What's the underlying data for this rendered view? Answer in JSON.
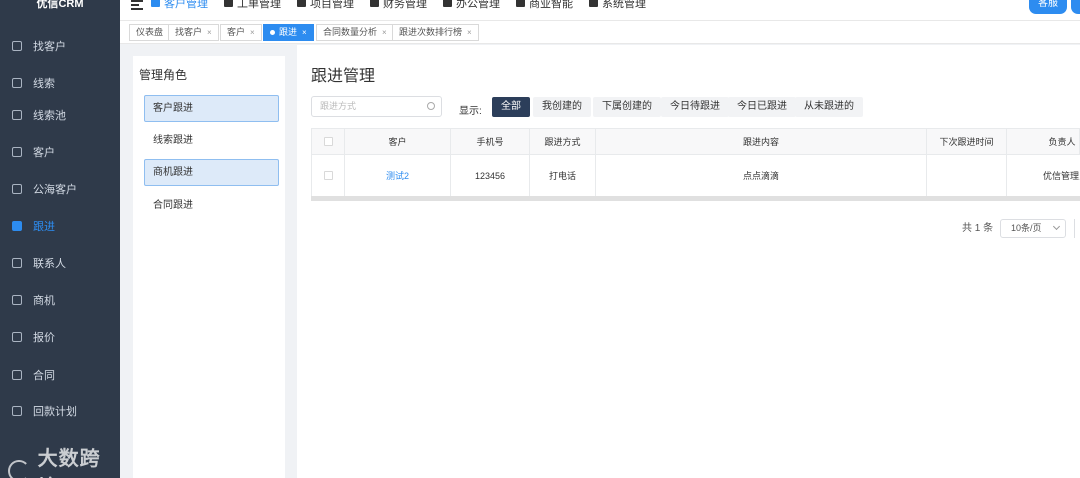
{
  "app": {
    "logo_text": "优信CRM"
  },
  "sidebar": {
    "items": [
      {
        "label": "找客户",
        "icon": "search-user-icon",
        "active": false
      },
      {
        "label": "线索",
        "icon": "edit-icon",
        "active": false
      },
      {
        "label": "线索池",
        "icon": "pool-icon",
        "active": false
      },
      {
        "label": "客户",
        "icon": "customer-icon",
        "active": false
      },
      {
        "label": "公海客户",
        "icon": "user-icon",
        "active": false
      },
      {
        "label": "跟进",
        "icon": "followup-icon",
        "active": true
      },
      {
        "label": "联系人",
        "icon": "contact-icon",
        "active": false
      },
      {
        "label": "商机",
        "icon": "opportunity-icon",
        "active": false
      },
      {
        "label": "报价",
        "icon": "quote-icon",
        "active": false
      },
      {
        "label": "合同",
        "icon": "contract-icon",
        "active": false
      },
      {
        "label": "回款计划",
        "icon": "payment-plan-icon",
        "active": false
      }
    ],
    "bottom_label": "回款"
  },
  "watermark": {
    "text": "大数跨境"
  },
  "topnav": {
    "items": [
      {
        "label": "客户管理",
        "active": true
      },
      {
        "label": "工单管理",
        "active": false
      },
      {
        "label": "项目管理",
        "active": false
      },
      {
        "label": "财务管理",
        "active": false
      },
      {
        "label": "办公管理",
        "active": false
      },
      {
        "label": "商业智能",
        "active": false
      },
      {
        "label": "系统管理",
        "active": false
      }
    ],
    "service_button": "客服"
  },
  "tabs": [
    {
      "label": "仪表盘",
      "closable": false,
      "active": false
    },
    {
      "label": "找客户",
      "closable": true,
      "active": false
    },
    {
      "label": "客户",
      "closable": true,
      "active": false
    },
    {
      "label": "跟进",
      "closable": true,
      "active": true
    },
    {
      "label": "合同数量分析",
      "closable": true,
      "active": false
    },
    {
      "label": "跟进次数排行榜",
      "closable": true,
      "active": false
    }
  ],
  "role_panel": {
    "title": "管理角色",
    "items": [
      {
        "label": "客户跟进",
        "selected": true
      },
      {
        "label": "线索跟进",
        "selected": false
      },
      {
        "label": "商机跟进",
        "selected": true
      },
      {
        "label": "合同跟进",
        "selected": false
      }
    ]
  },
  "main": {
    "title": "跟进管理",
    "search_placeholder": "跟进方式",
    "filter_label": "显示:",
    "filters": [
      {
        "label": "全部",
        "active": true
      },
      {
        "label": "我创建的",
        "active": false
      },
      {
        "label": "下属创建的",
        "active": false
      },
      {
        "label": "今日待跟进",
        "active": false
      },
      {
        "label": "今日已跟进",
        "active": false
      },
      {
        "label": "从未跟进的",
        "active": false
      }
    ],
    "table": {
      "columns": [
        "客户",
        "手机号",
        "跟进方式",
        "跟进内容",
        "下次跟进时间",
        "负责人"
      ],
      "rows": [
        {
          "customer": "测试2",
          "phone": "123456",
          "method": "打电话",
          "content": "点点滴滴",
          "next_time": "",
          "owner": "优信管理员"
        }
      ]
    },
    "pagination": {
      "total": "共 1 条",
      "page_size": "10条/页"
    }
  }
}
